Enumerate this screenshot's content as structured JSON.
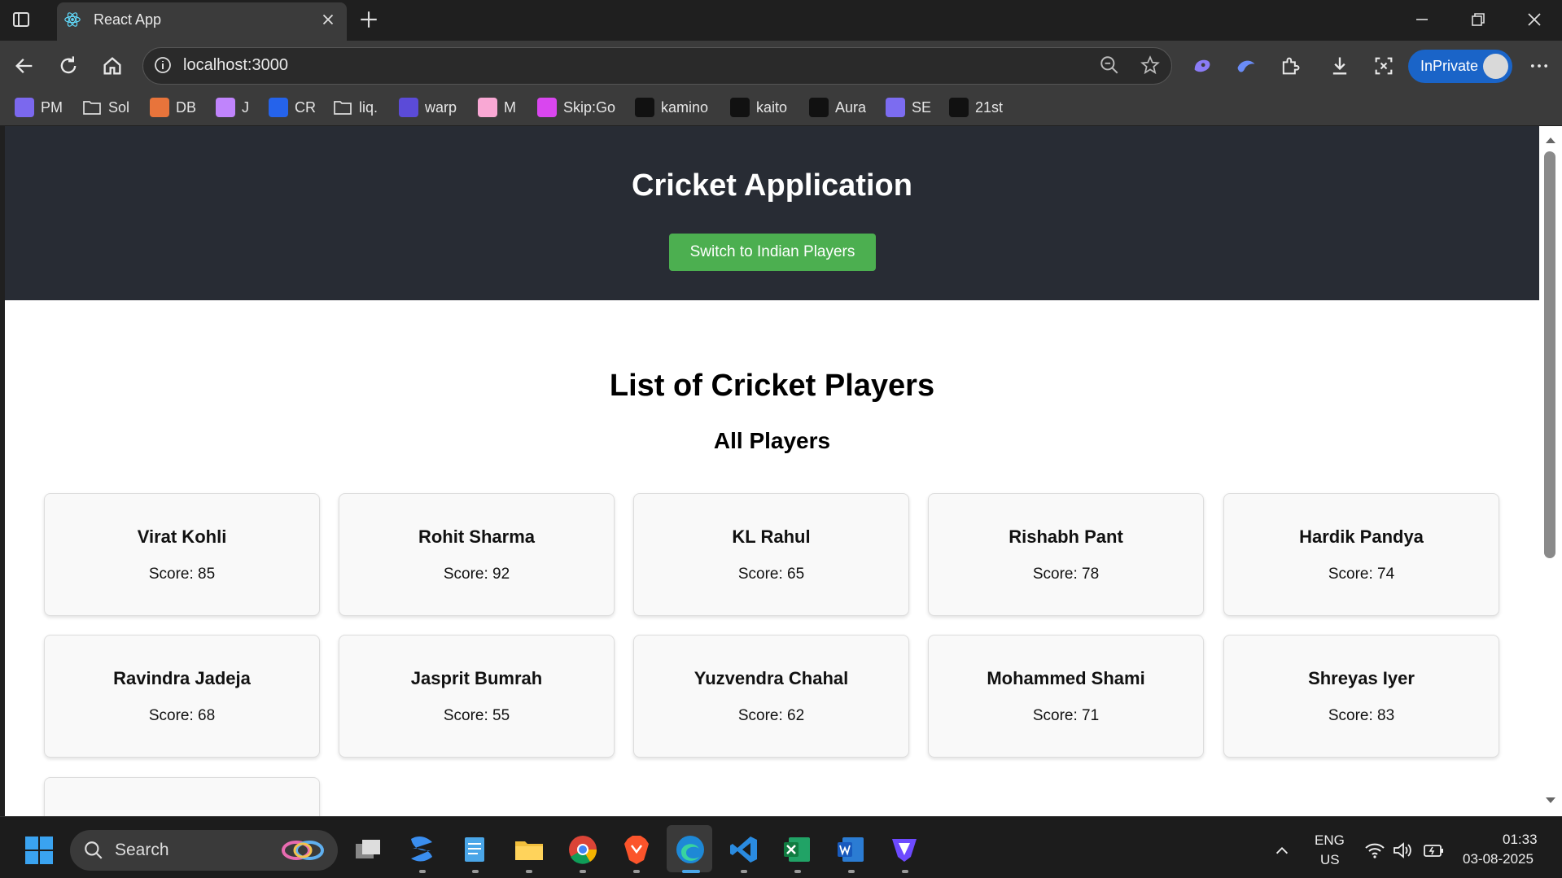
{
  "browser": {
    "tab_title": "React App",
    "url": "localhost:3000",
    "inprivate_label": "InPrivate",
    "bookmarks": [
      {
        "label": "PM",
        "icon": "gmail-icon",
        "color": "#7b68ee"
      },
      {
        "label": "Sol",
        "icon": "folder-icon",
        "color": "#cccccc"
      },
      {
        "label": "DB",
        "icon": "db-icon",
        "color": "#e8743b"
      },
      {
        "label": "J",
        "icon": "jupiter-icon",
        "color": "#c084fc"
      },
      {
        "label": "CR",
        "icon": "cr-icon",
        "color": "#2563eb"
      },
      {
        "label": "liq.",
        "icon": "folder-icon",
        "color": "#cccccc"
      },
      {
        "label": "warp",
        "icon": "warp-icon",
        "color": "#5b4bd8"
      },
      {
        "label": "M",
        "icon": "m-icon",
        "color": "#f9a8d4"
      },
      {
        "label": "Skip:Go",
        "icon": "skip-icon",
        "color": "#d946ef"
      },
      {
        "label": "kamino",
        "icon": "kamino-icon",
        "color": "#111111"
      },
      {
        "label": "kaito",
        "icon": "kaito-icon",
        "color": "#111111"
      },
      {
        "label": "Aura",
        "icon": "aura-icon",
        "color": "#111111"
      },
      {
        "label": "SE",
        "icon": "se-icon",
        "color": "#7c6cf0"
      },
      {
        "label": "21st",
        "icon": "21st-icon",
        "color": "#111111"
      }
    ]
  },
  "app": {
    "title": "Cricket Application",
    "switch_button": "Switch to Indian Players",
    "list_title": "List of Cricket Players",
    "list_subtitle": "All Players",
    "score_prefix": "Score: ",
    "players": [
      {
        "name": "Virat Kohli",
        "score": 85
      },
      {
        "name": "Rohit Sharma",
        "score": 92
      },
      {
        "name": "KL Rahul",
        "score": 65
      },
      {
        "name": "Rishabh Pant",
        "score": 78
      },
      {
        "name": "Hardik Pandya",
        "score": 74
      },
      {
        "name": "Ravindra Jadeja",
        "score": 68
      },
      {
        "name": "Jasprit Bumrah",
        "score": 55
      },
      {
        "name": "Yuzvendra Chahal",
        "score": 62
      },
      {
        "name": "Mohammed Shami",
        "score": 71
      },
      {
        "name": "Shreyas Iyer",
        "score": 83
      }
    ],
    "colors": {
      "header": "#282c34",
      "button": "#4caf50"
    }
  },
  "taskbar": {
    "search_label": "Search",
    "lang_line1": "ENG",
    "lang_line2": "US",
    "time": "01:33",
    "date": "03-08-2025"
  }
}
